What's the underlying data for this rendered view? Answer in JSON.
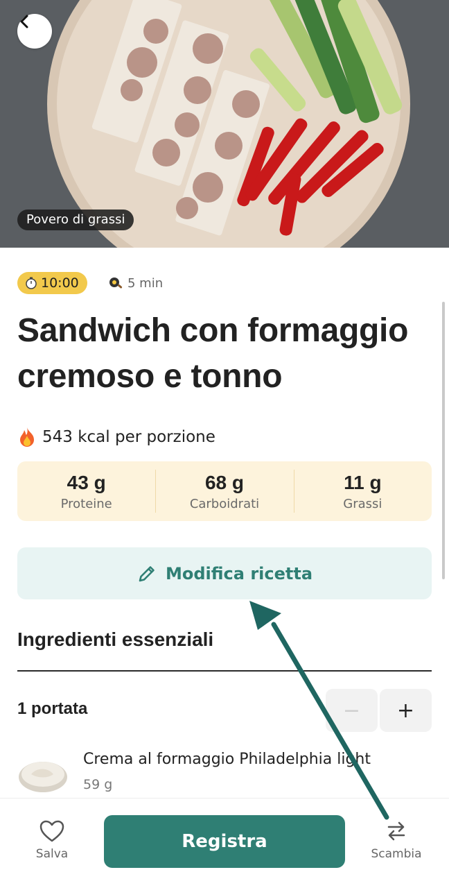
{
  "hero": {
    "badge": "Povero di grassi",
    "back_icon": "chevron-left-icon"
  },
  "meta": {
    "time": "10:00",
    "prep_time": "5 min",
    "timer_icon": "stopwatch-icon",
    "prep_icon": "frying-pan-icon",
    "timer_color": "#f2c94c"
  },
  "recipe": {
    "title": "Sandwich con formaggio cremoso e tonno",
    "calories": "543 kcal per porzione",
    "calories_icon": "fire-icon"
  },
  "macros": [
    {
      "value": "43 g",
      "label": "Proteine"
    },
    {
      "value": "68 g",
      "label": "Carboidrati"
    },
    {
      "value": "11 g",
      "label": "Grassi"
    }
  ],
  "edit": {
    "label": "Modifica ricetta",
    "icon": "pencil-icon"
  },
  "ingredients": {
    "title": "Ingredienti essenziali",
    "servings": "1 portata",
    "minus": "−",
    "plus": "+",
    "items": [
      {
        "name": "Crema al formaggio Philadelphia light",
        "quantity": "59 g"
      }
    ]
  },
  "bottom_bar": {
    "save_label": "Salva",
    "save_icon": "heart-icon",
    "register_label": "Registra",
    "swap_label": "Scambia",
    "swap_icon": "swap-arrows-icon"
  },
  "colors": {
    "accent": "#2f7f74",
    "accent_light": "#e8f4f3",
    "macro_bg": "#fdf3dc",
    "arrow": "#1f6661"
  }
}
